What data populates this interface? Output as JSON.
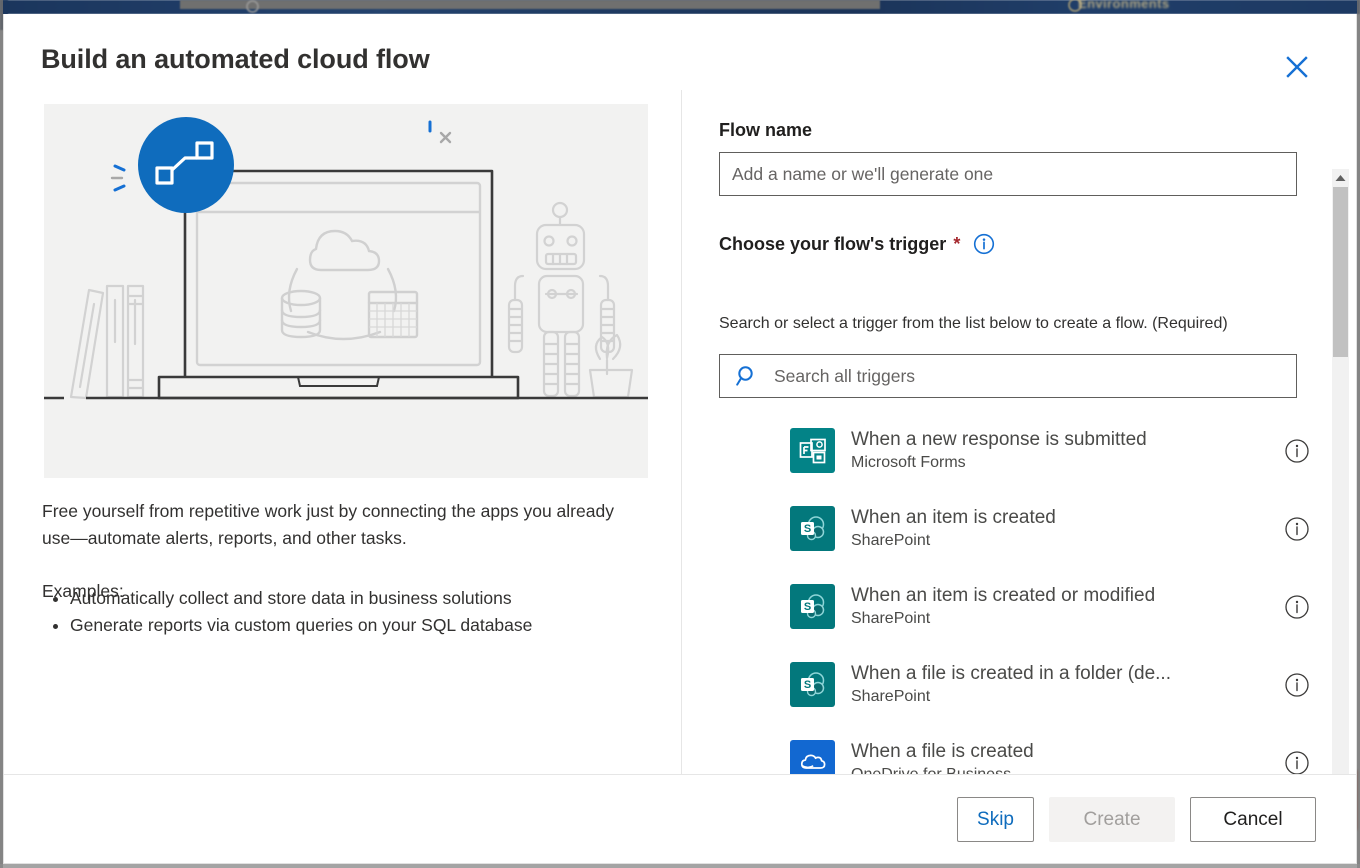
{
  "background": {
    "env_label": "Environments"
  },
  "modal": {
    "title": "Build an automated cloud flow",
    "close_icon": "close-icon",
    "close_color": "#0f6cbd"
  },
  "left": {
    "illustration_alt": "laptop-cloud-robot-illustration",
    "description": "Free yourself from repetitive work just by connecting the apps you already use—automate alerts, reports, and other tasks.",
    "examples_label": "Examples:",
    "examples": [
      "Automatically collect and store data in business solutions",
      "Generate reports via custom queries on your SQL database"
    ]
  },
  "right": {
    "flow_name_label": "Flow name",
    "flow_name_value": "",
    "flow_name_placeholder": "Add a name or we'll generate one",
    "trigger_label": "Choose your flow's trigger",
    "required_marker": "*",
    "trigger_info_icon": "info-circle-icon",
    "helper_text": "Search or select a trigger from the list below to create a flow. (Required)",
    "search_icon": "search-icon",
    "search_value": "",
    "search_placeholder": "Search all triggers",
    "triggers": [
      {
        "title": "When a new response is submitted",
        "connector": "Microsoft Forms",
        "icon": "microsoft-forms-icon",
        "icon_color": "#038387",
        "info_icon": "info-circle-icon"
      },
      {
        "title": "When an item is created",
        "connector": "SharePoint",
        "icon": "sharepoint-icon",
        "icon_color": "#03787c",
        "info_icon": "info-circle-icon"
      },
      {
        "title": "When an item is created or modified",
        "connector": "SharePoint",
        "icon": "sharepoint-icon",
        "icon_color": "#03787c",
        "info_icon": "info-circle-icon"
      },
      {
        "title": "When a file is created in a folder (de...",
        "connector": "SharePoint",
        "icon": "sharepoint-icon",
        "icon_color": "#03787c",
        "info_icon": "info-circle-icon"
      },
      {
        "title": "When a file is created",
        "connector": "OneDrive for Business",
        "icon": "onedrive-icon",
        "icon_color": "#1268d1",
        "info_icon": "info-circle-icon"
      }
    ],
    "scrollbar": {
      "up_icon": "caret-up-icon",
      "down_icon": "caret-down-icon"
    }
  },
  "footer": {
    "skip_label": "Skip",
    "create_label": "Create",
    "cancel_label": "Cancel"
  },
  "colors": {
    "accent": "#0f6cbd",
    "required": "#a4262c",
    "illustration_bg": "#f2f2f1",
    "disabled_bg": "#f3f2f1"
  }
}
